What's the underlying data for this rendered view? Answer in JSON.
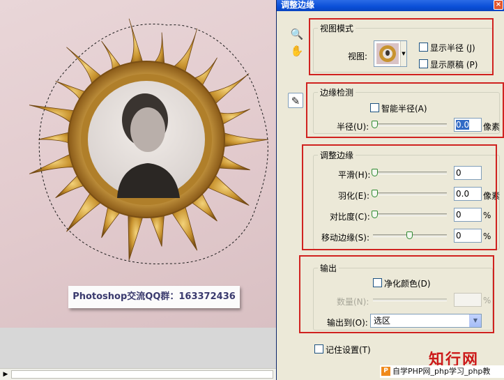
{
  "canvas": {
    "banner_text": "Photoshop交流QQ群：163372436"
  },
  "dialog": {
    "title": "调整边缘",
    "close_glyph": "×",
    "tools": {
      "zoom_glyph": "🔍",
      "hand_glyph": "✋",
      "brush_glyph": "✎"
    },
    "view_mode": {
      "legend": "视图模式",
      "view_label": "视图:",
      "show_radius": "显示半径 (J)",
      "show_original": "显示原稿 (P)"
    },
    "edge_detection": {
      "legend": "边缘检测",
      "smart_radius": "智能半径(A)",
      "radius_label": "半径(U):",
      "radius_value": "0.0",
      "radius_unit": "像素"
    },
    "adjust_edge": {
      "legend": "调整边缘",
      "smooth_label": "平滑(H):",
      "smooth_value": "0",
      "feather_label": "羽化(E):",
      "feather_value": "0.0",
      "feather_unit": "像素",
      "contrast_label": "对比度(C):",
      "contrast_value": "0",
      "contrast_unit": "%",
      "shift_label": "移动边缘(S):",
      "shift_value": "0",
      "shift_unit": "%"
    },
    "output": {
      "legend": "输出",
      "decontaminate": "净化颜色(D)",
      "amount_label": "数量(N):",
      "amount_unit": "%",
      "output_to_label": "输出到(O):",
      "output_to_value": "选区"
    },
    "remember": "记住设置(T)"
  },
  "watermark": {
    "logo": "知行网",
    "badge": "P",
    "caption": "自学PHP网_php学习_php教"
  },
  "colors": {
    "title_blue": "#0a4fd8",
    "highlight_red": "#d0221f",
    "frame_gold": "#c8932f"
  }
}
